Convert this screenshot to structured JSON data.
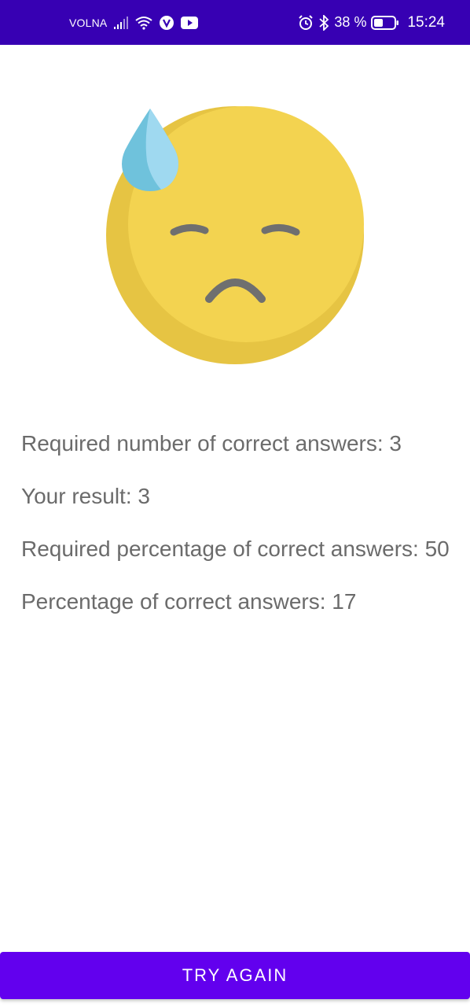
{
  "status_bar": {
    "carrier": "VOLNA",
    "battery_percent": "38 %",
    "time": "15:24",
    "icons": [
      "signal-icon",
      "wifi-icon",
      "vk-icon",
      "youtube-icon",
      "alarm-icon",
      "bluetooth-icon",
      "battery-icon"
    ],
    "background_color": "#3700b3"
  },
  "illustration": {
    "icon": "sad-sweat-emoji-icon",
    "face_color": "#f3d350",
    "drop_color": "#7fcbe6"
  },
  "results": {
    "required_correct": "Required number of correct answers: 3",
    "your_result": "Your result: 3",
    "required_percentage": "Required percentage of correct answers: 50",
    "percentage_correct": "Percentage of correct answers: 17"
  },
  "button": {
    "label": "TRY AGAIN",
    "color": "#6200ee"
  }
}
